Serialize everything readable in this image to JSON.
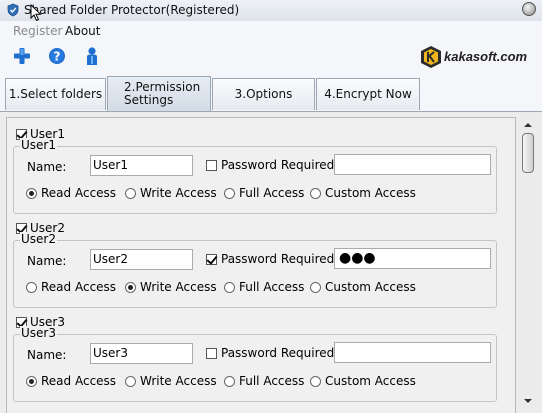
{
  "window": {
    "title": "Shared Folder Protector(Registered)"
  },
  "menu": {
    "items": [
      {
        "label": "Register"
      },
      {
        "label": "About"
      }
    ]
  },
  "toolbar": {
    "buttons": [
      {
        "icon": "plus-icon"
      },
      {
        "icon": "help-icon"
      },
      {
        "icon": "user-icon"
      }
    ],
    "logo_text": "kakasoft.com"
  },
  "tabs": [
    {
      "label": "1.Select folders",
      "active": false
    },
    {
      "label": "2.Permission Settings",
      "active": true
    },
    {
      "label": "3.Options",
      "active": false
    },
    {
      "label": "4.Encrypt Now",
      "active": false
    }
  ],
  "labels": {
    "name": "Name:",
    "password_required": "Password Required",
    "access_options": [
      "Read Access",
      "Write Access",
      "Full Access",
      "Custom Access"
    ]
  },
  "users": [
    {
      "checkbox_label": "User1",
      "checked": true,
      "group_label": "User1",
      "name_value": "User1",
      "password_required": false,
      "password_value": "",
      "selected_access": "Read Access"
    },
    {
      "checkbox_label": "User2",
      "checked": true,
      "group_label": "User2",
      "name_value": "User2",
      "password_required": true,
      "password_value": "●●●",
      "selected_access": "Write Access"
    },
    {
      "checkbox_label": "User3",
      "checked": true,
      "group_label": "User3",
      "name_value": "User3",
      "password_required": false,
      "password_value": "",
      "selected_access": "Read Access"
    }
  ],
  "colors": {
    "accent_blue": "#1e6fd0",
    "titlebar": "#e6ebf1",
    "panel": "#f0f0f0"
  }
}
